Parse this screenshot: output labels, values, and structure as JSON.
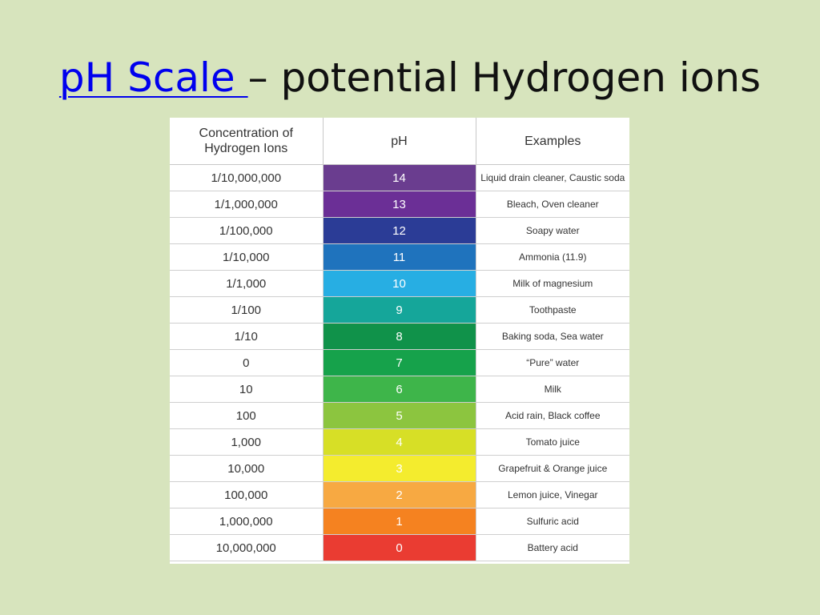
{
  "slide": {
    "title_link": "pH Scale ",
    "title_rest": "– potential Hydrogen ions"
  },
  "table": {
    "headers": [
      "Concentration of Hydrogen Ions",
      "pH",
      "Examples"
    ],
    "rows": [
      {
        "conc": "1/10,000,000",
        "ph": "14",
        "example": "Liquid drain cleaner, Caustic soda",
        "color": "#6a3d8f"
      },
      {
        "conc": "1/1,000,000",
        "ph": "13",
        "example": "Bleach, Oven cleaner",
        "color": "#6b2f96"
      },
      {
        "conc": "1/100,000",
        "ph": "12",
        "example": "Soapy water",
        "color": "#2b3c96"
      },
      {
        "conc": "1/10,000",
        "ph": "11",
        "example": "Ammonia (11.9)",
        "color": "#1f73bd"
      },
      {
        "conc": "1/1,000",
        "ph": "10",
        "example": "Milk of magnesium",
        "color": "#27aee3"
      },
      {
        "conc": "1/100",
        "ph": "9",
        "example": "Toothpaste",
        "color": "#15a69a"
      },
      {
        "conc": "1/10",
        "ph": "8",
        "example": "Baking soda, Sea water",
        "color": "#10924a"
      },
      {
        "conc": "0",
        "ph": "7",
        "example": "“Pure” water",
        "color": "#16a24b"
      },
      {
        "conc": "10",
        "ph": "6",
        "example": "Milk",
        "color": "#3eb54a"
      },
      {
        "conc": "100",
        "ph": "5",
        "example": "Acid rain, Black coffee",
        "color": "#8cc53f"
      },
      {
        "conc": "1,000",
        "ph": "4",
        "example": "Tomato juice",
        "color": "#d7df26"
      },
      {
        "conc": "10,000",
        "ph": "3",
        "example": "Grapefruit & Orange juice",
        "color": "#f4ec2e"
      },
      {
        "conc": "100,000",
        "ph": "2",
        "example": "Lemon juice, Vinegar",
        "color": "#f7a942"
      },
      {
        "conc": "1,000,000",
        "ph": "1",
        "example": "Sulfuric acid",
        "color": "#f58220"
      },
      {
        "conc": "10,000,000",
        "ph": "0",
        "example": "Battery acid",
        "color": "#ea3c32"
      }
    ]
  }
}
